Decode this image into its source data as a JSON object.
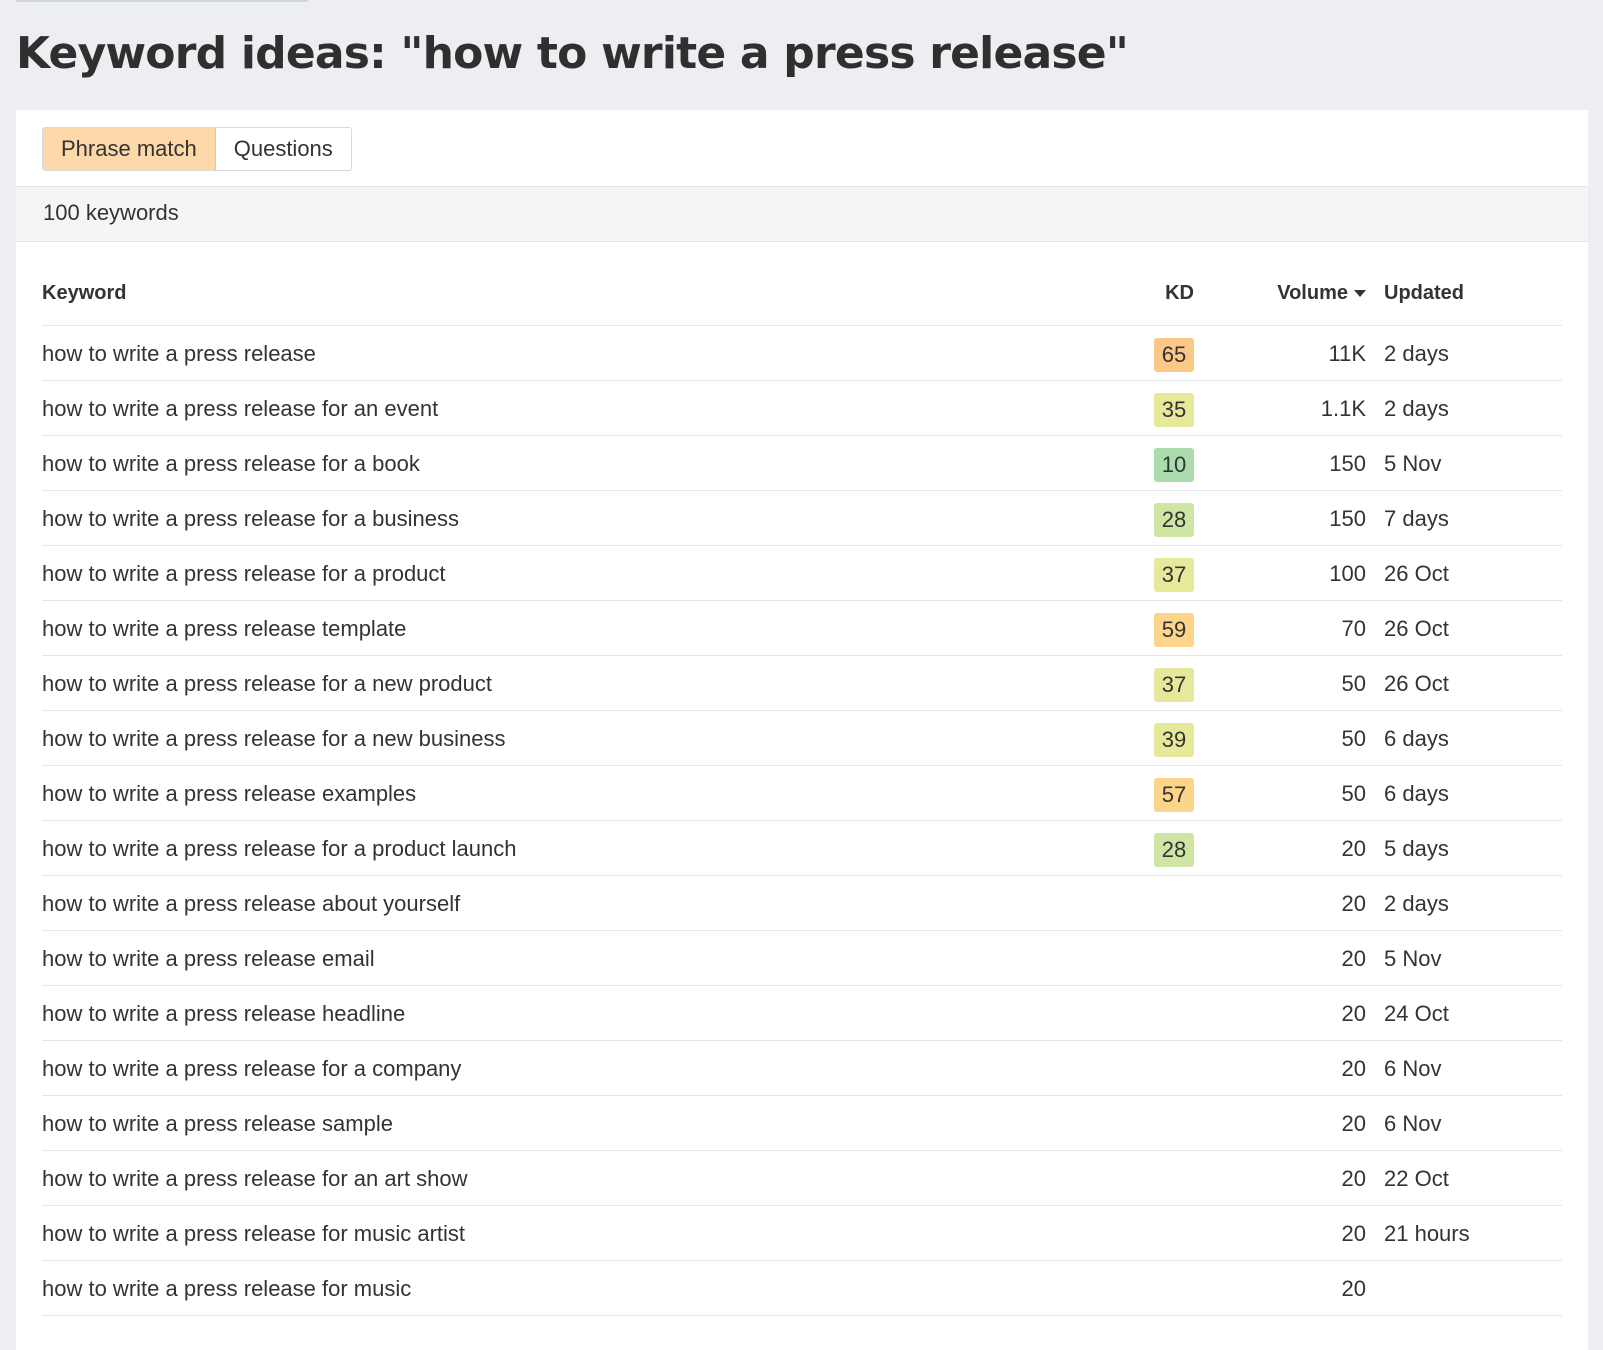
{
  "page": {
    "title": "Keyword ideas: \"how to write a press release\""
  },
  "tabs": [
    {
      "label": "Phrase match",
      "active": true
    },
    {
      "label": "Questions",
      "active": false
    }
  ],
  "summary": {
    "count_text": "100 keywords"
  },
  "table": {
    "columns": {
      "keyword": "Keyword",
      "kd": "KD",
      "volume": "Volume",
      "updated": "Updated"
    },
    "sort": {
      "column": "Volume",
      "direction": "descending",
      "icon": "sort-down-icon"
    },
    "kd_colors": {
      "10": "#aadcad",
      "28": "#cfe5a4",
      "35": "#e7e99a",
      "37": "#e7e99a",
      "39": "#e7e99a",
      "57": "#fcd58a",
      "59": "#fcd58a",
      "65": "#fbc888"
    },
    "rows": [
      {
        "keyword": "how to write a press release",
        "kd": "65",
        "volume": "11K",
        "updated": "2 days"
      },
      {
        "keyword": "how to write a press release for an event",
        "kd": "35",
        "volume": "1.1K",
        "updated": "2 days"
      },
      {
        "keyword": "how to write a press release for a book",
        "kd": "10",
        "volume": "150",
        "updated": "5 Nov"
      },
      {
        "keyword": "how to write a press release for a business",
        "kd": "28",
        "volume": "150",
        "updated": "7 days"
      },
      {
        "keyword": "how to write a press release for a product",
        "kd": "37",
        "volume": "100",
        "updated": "26 Oct"
      },
      {
        "keyword": "how to write a press release template",
        "kd": "59",
        "volume": "70",
        "updated": "26 Oct"
      },
      {
        "keyword": "how to write a press release for a new product",
        "kd": "37",
        "volume": "50",
        "updated": "26 Oct"
      },
      {
        "keyword": "how to write a press release for a new business",
        "kd": "39",
        "volume": "50",
        "updated": "6 days"
      },
      {
        "keyword": "how to write a press release examples",
        "kd": "57",
        "volume": "50",
        "updated": "6 days"
      },
      {
        "keyword": "how to write a press release for a product launch",
        "kd": "28",
        "volume": "20",
        "updated": "5 days"
      },
      {
        "keyword": "how to write a press release about yourself",
        "kd": "",
        "volume": "20",
        "updated": "2 days"
      },
      {
        "keyword": "how to write a press release email",
        "kd": "",
        "volume": "20",
        "updated": "5 Nov"
      },
      {
        "keyword": "how to write a press release headline",
        "kd": "",
        "volume": "20",
        "updated": "24 Oct"
      },
      {
        "keyword": "how to write a press release for a company",
        "kd": "",
        "volume": "20",
        "updated": "6 Nov"
      },
      {
        "keyword": "how to write a press release sample",
        "kd": "",
        "volume": "20",
        "updated": "6 Nov"
      },
      {
        "keyword": "how to write a press release for an art show",
        "kd": "",
        "volume": "20",
        "updated": "22 Oct"
      },
      {
        "keyword": "how to write a press release for music artist",
        "kd": "",
        "volume": "20",
        "updated": "21 hours"
      },
      {
        "keyword": "how to write a press release for music",
        "kd": "",
        "volume": "20",
        "updated": ""
      }
    ]
  }
}
